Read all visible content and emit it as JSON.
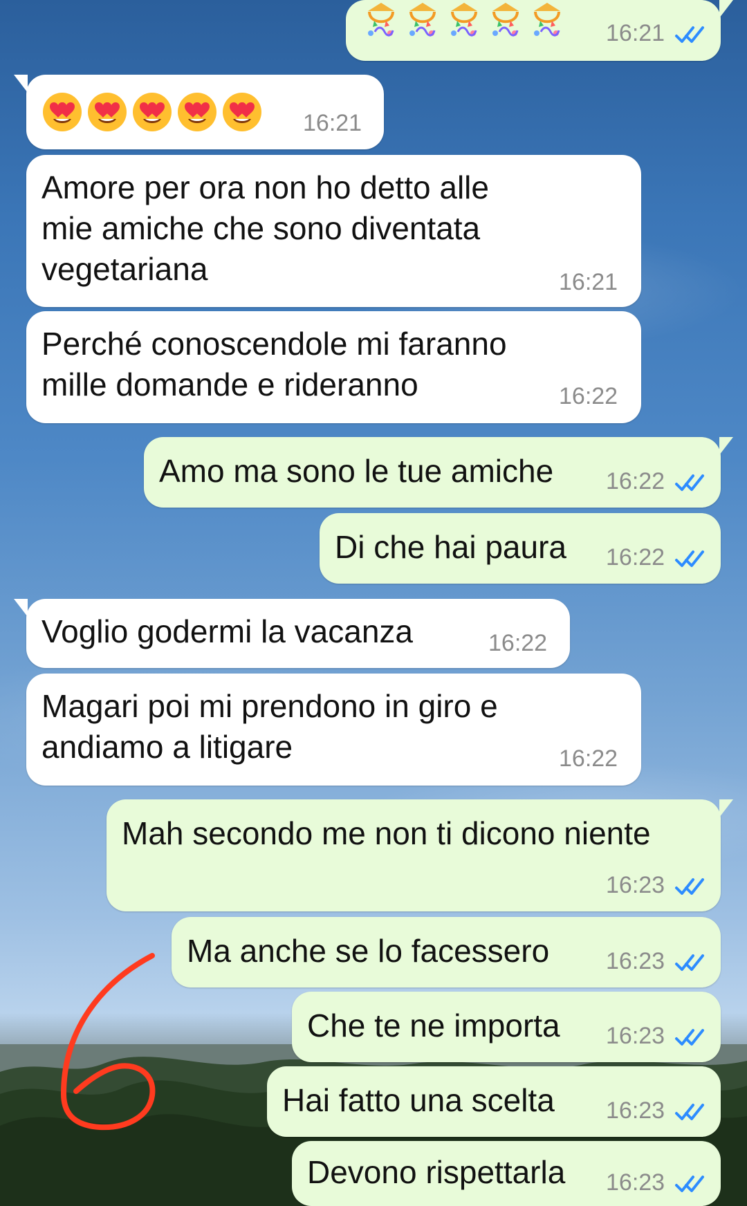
{
  "chat": {
    "messages": [
      {
        "text": "",
        "time": "16:21",
        "status": "read"
      },
      {
        "text": "",
        "time": "16:21"
      },
      {
        "text": "Amore per ora non ho detto alle\nmie amiche che sono diventata\nvegetariana",
        "time": "16:21"
      },
      {
        "text": "Perché conoscendole mi faranno\nmille domande e rideranno",
        "time": "16:22"
      },
      {
        "text": "Amo ma sono le tue amiche",
        "time": "16:22",
        "status": "read"
      },
      {
        "text": "Di che hai paura",
        "time": "16:22",
        "status": "read"
      },
      {
        "text": "Voglio godermi la vacanza",
        "time": "16:22"
      },
      {
        "text": "Magari poi mi prendono in giro e\nandiamo a litigare",
        "time": "16:22"
      },
      {
        "text": "Mah secondo me non ti dicono niente",
        "time": "16:23",
        "status": "read"
      },
      {
        "text": "Ma anche se lo facessero",
        "time": "16:23",
        "status": "read"
      },
      {
        "text": "Che te ne importa",
        "time": "16:23",
        "status": "read"
      },
      {
        "text": "Hai fatto una scelta",
        "time": "16:23",
        "status": "read"
      },
      {
        "text": "Devono rispettarla",
        "time": "16:23",
        "status": "read"
      }
    ],
    "emoji_messages": {
      "party_message": {
        "emoji": "party-popper-icon",
        "count": 5
      },
      "heart_eyes_message": {
        "emoji": "heart-eyes-icon",
        "count": 5
      }
    }
  },
  "colors": {
    "incoming_bubble": "#ffffff",
    "outgoing_bubble": "#e8fbd9",
    "timestamp": "#8b8b8b",
    "read_ticks": "#2d8cff",
    "annotation_stroke": "#ff3b1f"
  }
}
